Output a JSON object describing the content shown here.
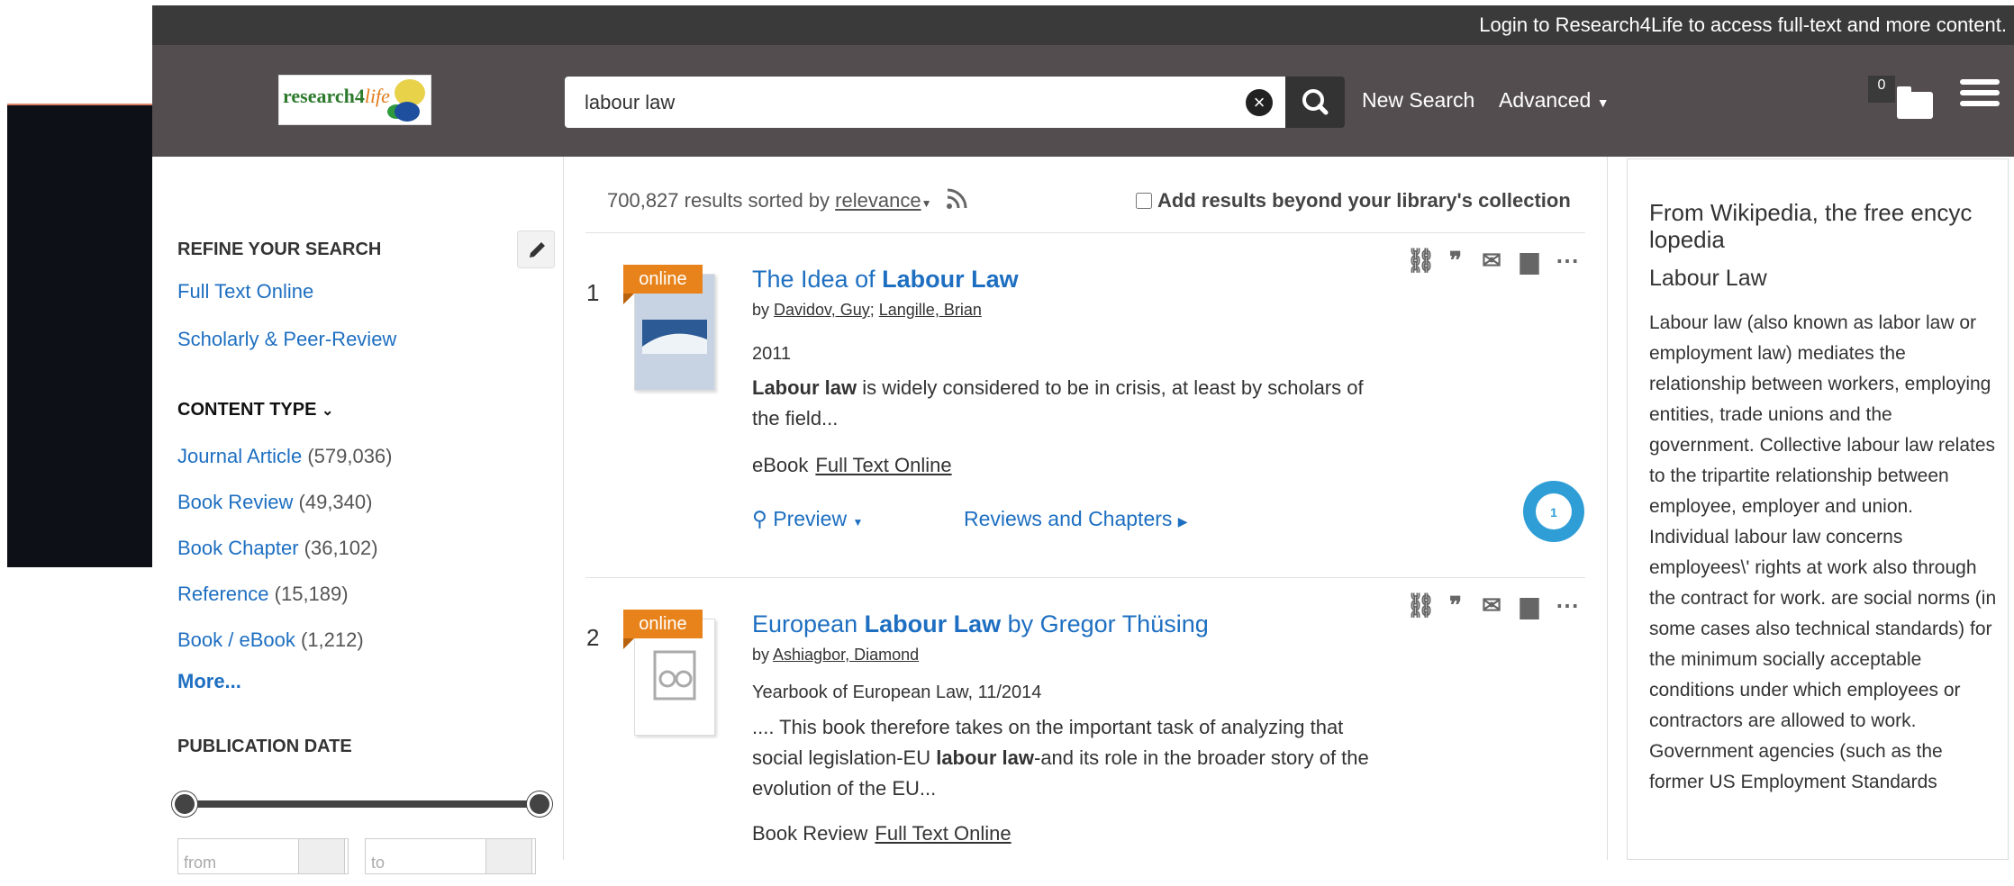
{
  "topbar": {
    "login_text": "Login to Research4Life to access full-text and more content."
  },
  "header": {
    "logo_text_a": "research4",
    "logo_text_b": "life",
    "search_value": "labour law",
    "new_search": "New Search",
    "advanced": "Advanced",
    "cart_count": "0"
  },
  "sidebar": {
    "refine_title": "REFINE YOUR SEARCH",
    "filters": [
      "Full Text Online",
      "Scholarly & Peer-Review"
    ],
    "content_type_title": "CONTENT TYPE",
    "content_types": [
      {
        "label": "Journal Article",
        "count": "(579,036)"
      },
      {
        "label": "Book Review",
        "count": "(49,340)"
      },
      {
        "label": "Book Chapter",
        "count": "(36,102)"
      },
      {
        "label": "Reference",
        "count": "(15,189)"
      },
      {
        "label": "Book / eBook",
        "count": "(1,212)"
      }
    ],
    "more": "More...",
    "pub_date_title": "PUBLICATION DATE",
    "from_placeholder": "from",
    "to_placeholder": "to"
  },
  "results": {
    "count_text": "700,827 results sorted by",
    "sort": "relevance",
    "beyond_label": "Add results beyond your library's collection",
    "items": [
      {
        "num": "1",
        "badge": "online",
        "title_a": "The Idea of ",
        "title_b": "Labour Law",
        "title_c": "",
        "by": "by",
        "authors": [
          "Davidov, Guy",
          "Langille, Brian"
        ],
        "meta": "2011",
        "snippet_bold": "Labour law",
        "snippet_rest": " is widely considered to be in crisis, at least by scholars of the field...",
        "type": "eBook",
        "fulltext": "Full Text Online",
        "preview": "Preview",
        "reviews": "Reviews and Chapters",
        "altmetric": "1"
      },
      {
        "num": "2",
        "badge": "online",
        "title_a": "European ",
        "title_b": "Labour Law",
        "title_c": " by Gregor Thüsing",
        "by": "by",
        "authors": [
          "Ashiagbor, Diamond"
        ],
        "meta": "Yearbook of European Law, 11/2014",
        "snippet_a": ".... This book therefore takes on the important task of analyzing that social legislation-EU ",
        "snippet_bold": "labour law",
        "snippet_c": "-and its role in the broader story of the evolution of the EU...",
        "type": "Book Review",
        "fulltext": "Full Text Online"
      }
    ]
  },
  "wiki": {
    "heading": "From Wikipedia, the free encyc lopedia",
    "subheading": "Labour Law",
    "body": "Labour law (also known as labor law or employment law) mediates the relationship between workers, employing entities, trade unions and the government. Collective labour law relates to the tripartite relationship between employee, employer and union. Individual labour law concerns employees\\' rights at work also through the contract for work. are social norms (in some cases also technical standards) for the minimum socially acceptable conditions under which employees or contractors are allowed to work. Government agencies (such as the former US Employment Standards"
  },
  "colors": {
    "link": "#1e6fc1",
    "badge": "#e8831b",
    "header": "#544d4f",
    "topbar": "#3a3a3a"
  }
}
